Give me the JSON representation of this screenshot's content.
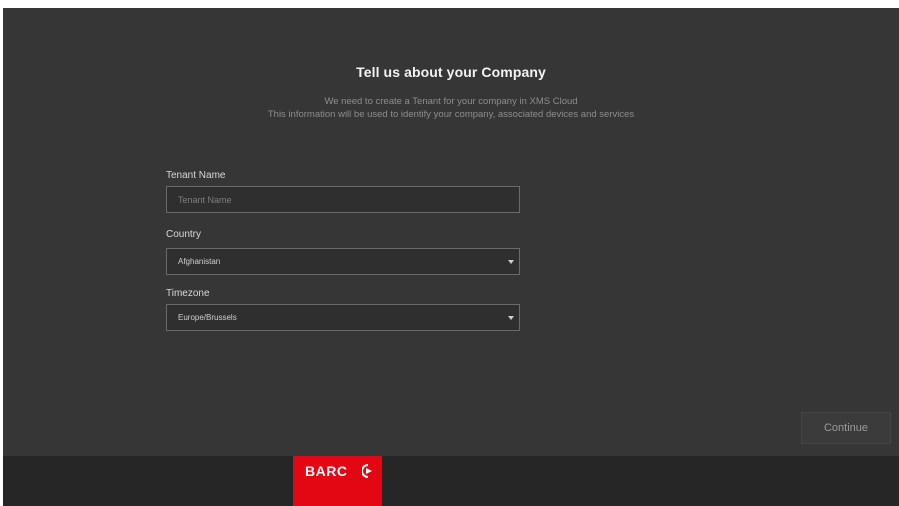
{
  "form": {
    "title": "Tell us about your Company",
    "subtitle_line1": "We need to create a Tenant for your company in XMS Cloud",
    "subtitle_line2": "This information will be used to identify your company, associated devices and services",
    "tenant_name": {
      "label": "Tenant Name",
      "placeholder": "Tenant Name",
      "value": ""
    },
    "country": {
      "label": "Country",
      "selected": "Afghanistan"
    },
    "timezone": {
      "label": "Timezone",
      "selected": "Europe/Brussels"
    }
  },
  "actions": {
    "continue_label": "Continue"
  },
  "footer": {
    "logo_text": "BARC",
    "logo_color": "#e30613"
  },
  "colors": {
    "background": "#363636",
    "footer": "#262626"
  },
  "icons": {
    "country_dropdown": "caret-down-icon",
    "timezone_dropdown": "caret-down-icon",
    "logo_mark": "barco-arrow-icon"
  }
}
